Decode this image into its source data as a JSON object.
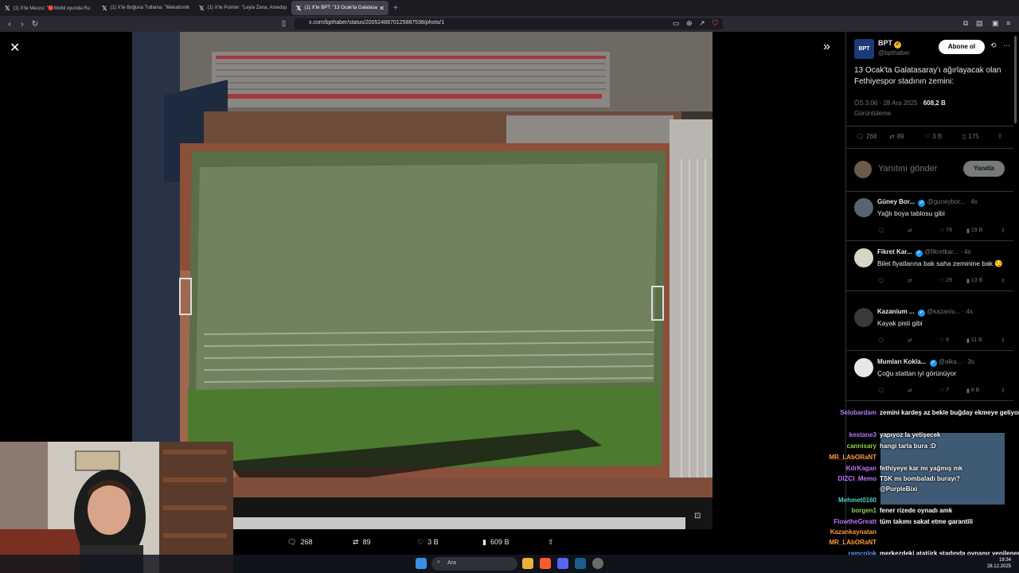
{
  "browser": {
    "tabs": [
      {
        "label": "(1) X'te Mevzu: \"🔴Mobil oyunda Ru"
      },
      {
        "label": "(1) X'te Boğuna Tıdlama: \"Mekatronik"
      },
      {
        "label": "(1) X'te Pointer: \"Leyla Zana, Amedsp"
      },
      {
        "label": "(1) X'te BPT: \"13 Ocak'ta Galatasa"
      }
    ],
    "url": "x.com/bpthaber/status/2005248870125887538/photo/1"
  },
  "photo_actions": {
    "replies": "268",
    "reposts": "89",
    "likes": "3 B",
    "views": "609 B"
  },
  "tweet": {
    "display_name": "BPT",
    "handle": "@bpthaber",
    "logo_text": "BPT",
    "subscribe_label": "Abone ol",
    "text": "13 Ocak'ta Galatasaray'ı ağırlayacak olan Fethiyespor stadının zemini:",
    "time": "ÖS 3:06 · 28 Ara 2025 · ",
    "views_count": "608,2 B",
    "views_label": "Görüntüleme",
    "stats": {
      "replies": "268",
      "reposts": "89",
      "likes": "3 B",
      "bookmarks": "175"
    }
  },
  "reply_box": {
    "placeholder": "Yanıtını gönder",
    "button": "Yanıtla"
  },
  "comments": [
    {
      "name": "Güney Bor...",
      "handle": "@guneybor...",
      "time": "· 4s",
      "text": "Yağlı boya tablosu gibi",
      "replies": "",
      "reposts": "",
      "likes": "78",
      "views": "19 B"
    },
    {
      "name": "Fikret Kar...",
      "handle": "@fikretkar...",
      "time": "· 4s",
      "text": "Bilet fiyatlarına bak saha zeminine bak 😏",
      "replies": "",
      "reposts": "",
      "likes": "29",
      "views": "13 B"
    },
    {
      "name": "Kazanium ...",
      "handle": "@kazaniu...",
      "time": "· 4s",
      "text": "Kayak pisti gibi",
      "replies": "",
      "reposts": "",
      "likes": "6",
      "views": "11 B"
    },
    {
      "name": "Mumları Kokla...",
      "handle": "@alka...",
      "time": "· 3s",
      "text": "Çoğu stattan iyi görünüyor",
      "replies": "",
      "reposts": "",
      "likes": "7",
      "views": "8 B"
    }
  ],
  "chat": [
    {
      "user": "Selobardam",
      "color": "#b37bff",
      "msg": "zemini kardeş az bekle buğday ekmeye geliyom mk"
    },
    {
      "user": "kestane3",
      "color": "#c070ff",
      "msg": "yapıyoz la yetişecek"
    },
    {
      "user": "cannisary",
      "color": "#8fd14f",
      "msg": "hangi tarla bura :D"
    },
    {
      "user": "MR_LAbORaNT",
      "color": "#ff9a3c",
      "msg": ""
    },
    {
      "user": "KdrKagan",
      "color": "#c070ff",
      "msg": "fethiyeye kar mı yağmış mk"
    },
    {
      "user": "DIZCI_Memo",
      "color": "#c070ff",
      "msg": "TSK mı bombaladı burayı?"
    },
    {
      "user": "",
      "color": "#ffffff",
      "msg": "@PurpleBixi"
    },
    {
      "user": "Mehmet0160",
      "color": "#4fd1c5",
      "msg": ""
    },
    {
      "user": "borgen1",
      "color": "#8fd14f",
      "msg": "fener rizede oynadı amk"
    },
    {
      "user": "FlowtheGreatt",
      "color": "#c070ff",
      "msg": "tüm takımı sakat etme garantili"
    },
    {
      "user": "Kazankaynatan",
      "color": "#ff9a3c",
      "msg": ""
    },
    {
      "user": "MR_LAbORaNT",
      "color": "#ff9a3c",
      "msg": ""
    },
    {
      "user": "ramcolok",
      "color": "#5aa0ff",
      "msg": "merkezdeki atatürk stadında oynanır yenilenen stad"
    }
  ],
  "taskbar": {
    "search": "Ara",
    "time": "19:34",
    "date": "28.12.2025"
  }
}
